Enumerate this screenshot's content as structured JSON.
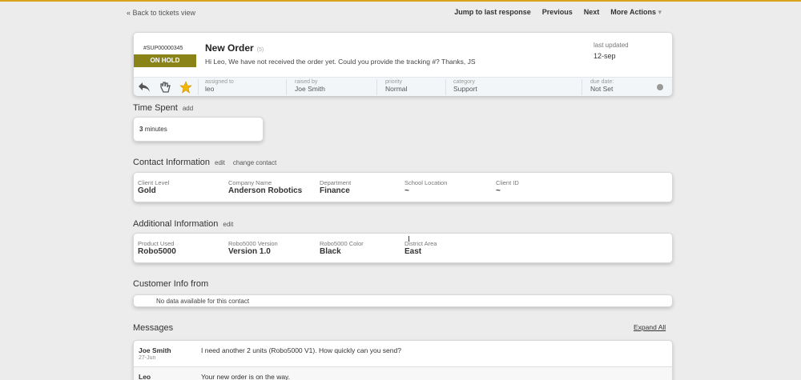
{
  "nav": {
    "back": "« Back to tickets view",
    "jump": "Jump to last response",
    "previous": "Previous",
    "next": "Next",
    "more": "More Actions"
  },
  "ticket": {
    "id": "#SUP00000345",
    "status": "ON HOLD",
    "title": "New Order",
    "count": "(5)",
    "message": "Hi Leo, We have not received the order yet. Could you provide the tracking #? Thanks, JS",
    "last_updated_label": "last updated",
    "last_updated_value": "12-sep",
    "meta": [
      {
        "label": "assigned to",
        "value": "leo"
      },
      {
        "label": "raised by",
        "value": "Joe Smith"
      },
      {
        "label": "priority",
        "value": "Normal"
      },
      {
        "label": "category",
        "value": "Support"
      },
      {
        "label": "due date:",
        "value": "Not Set"
      }
    ]
  },
  "time_spent": {
    "title": "Time Spent",
    "action": "add",
    "value": "3",
    "unit": "minutes"
  },
  "contact": {
    "title": "Contact Information",
    "edit": "edit",
    "change": "change contact",
    "fields": [
      {
        "label": "Client Level",
        "value": "Gold"
      },
      {
        "label": "Company Name",
        "value": "Anderson Robotics"
      },
      {
        "label": "Department",
        "value": "Finance"
      },
      {
        "label": "School Location",
        "value": "~"
      },
      {
        "label": "Client ID",
        "value": "~"
      }
    ]
  },
  "additional": {
    "title": "Additional Information",
    "edit": "edit",
    "fields": [
      {
        "label": "Product Used",
        "value": "Robo5000"
      },
      {
        "label": "Robo5000 Version",
        "value": "Version 1.0"
      },
      {
        "label": "Robo5000 Color",
        "value": "Black"
      },
      {
        "label": "District Area",
        "value": "East"
      }
    ]
  },
  "customer_info": {
    "title": "Customer Info from",
    "empty": "No data available for this contact"
  },
  "messages": {
    "title": "Messages",
    "expand": "Expand All",
    "items": [
      {
        "name": "Joe Smith",
        "date": "27-Jun",
        "text": "I need another 2 units (Robo5000 V1). How quickly can you send?"
      },
      {
        "name": "Leo",
        "date": "",
        "text": "Your new order is on the way."
      }
    ]
  },
  "colors": {
    "status": "#8a8418",
    "accent_top": "#d9a21b",
    "star": "#f2b705"
  }
}
